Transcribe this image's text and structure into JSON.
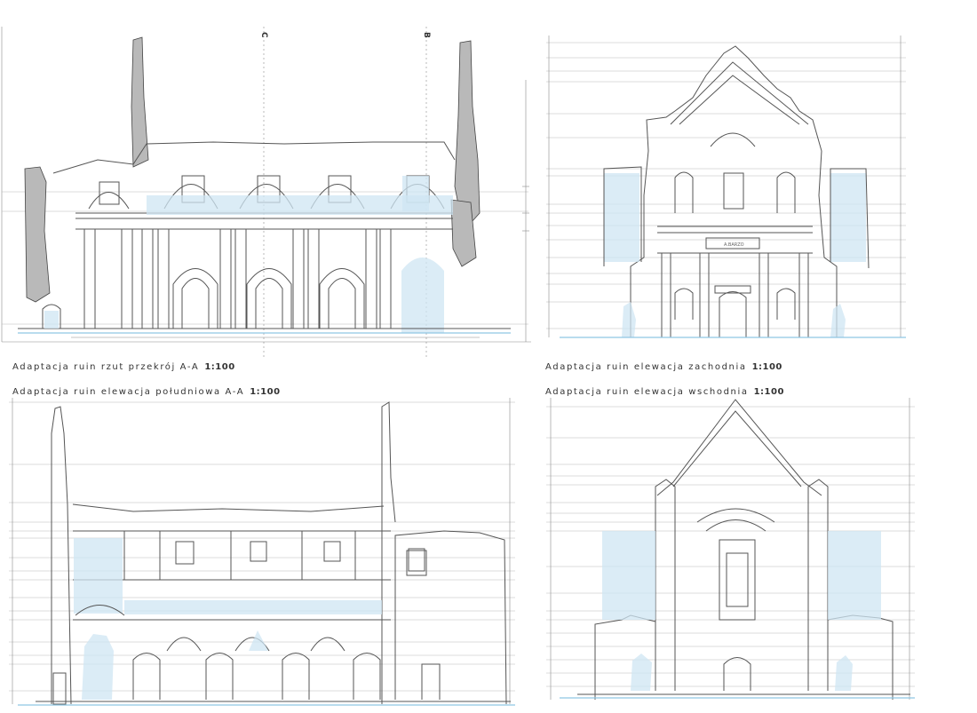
{
  "drawings": {
    "section_aa": {
      "caption_text": "Adaptacja ruin rzut przekrój A-A",
      "caption_scale": "1:100",
      "axis_c_label": "C",
      "axis_b_label": "B"
    },
    "west_elevation": {
      "caption_text": "Adaptacja ruin elewacja zachodnia",
      "caption_scale": "1:100",
      "sign_text": "A.BARZO"
    },
    "south_elevation": {
      "caption_text": "Adaptacja ruin elewacja południowa A-A",
      "caption_scale": "1:100"
    },
    "east_elevation": {
      "caption_text": "Adaptacja ruin elewacja wschodnia",
      "caption_scale": "1:100"
    }
  },
  "colors": {
    "line": "#555555",
    "glass_blue": "#cfe6f3",
    "glass_edge": "#8fc6e3",
    "hatch": "#b9b9b9"
  }
}
